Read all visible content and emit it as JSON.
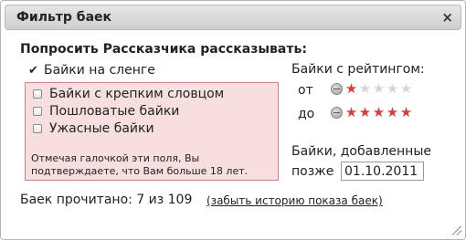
{
  "dialog": {
    "title": "Фильтр баек",
    "close_glyph": "×"
  },
  "heading": "Попросить Рассказчика рассказывать:",
  "slang": {
    "label": "Байки на сленге",
    "checked": true,
    "check_glyph": "✔"
  },
  "adult": {
    "items": [
      {
        "label": "Байки с крепким словцом",
        "checked": false
      },
      {
        "label": "Пошловатые байки",
        "checked": false
      },
      {
        "label": "Ужасные байки",
        "checked": false
      }
    ],
    "note": "Отмечая галочкой эти поля, Вы подтверждаете, что Вам больше 18 лет."
  },
  "rating": {
    "title": "Байки с рейтингом:",
    "from_label": "от",
    "from_value": 1,
    "to_label": "до",
    "to_value": 5,
    "max": 5,
    "star_glyph": "★",
    "on_color": "#cc4040",
    "off_color": "#d6d6d6"
  },
  "date": {
    "label": "Байки, добавленные",
    "prefix": "позже",
    "value": "01.10.2011"
  },
  "footer": {
    "read_text": "Баек прочитано: 7 из 109",
    "forget_link": "(забыть историю показа баек)"
  },
  "icons": {
    "close": "close-icon",
    "checkmark": "checkmark-icon",
    "minus": "minus-circle-icon",
    "star": "star-icon",
    "resize": "resize-grip-icon"
  }
}
